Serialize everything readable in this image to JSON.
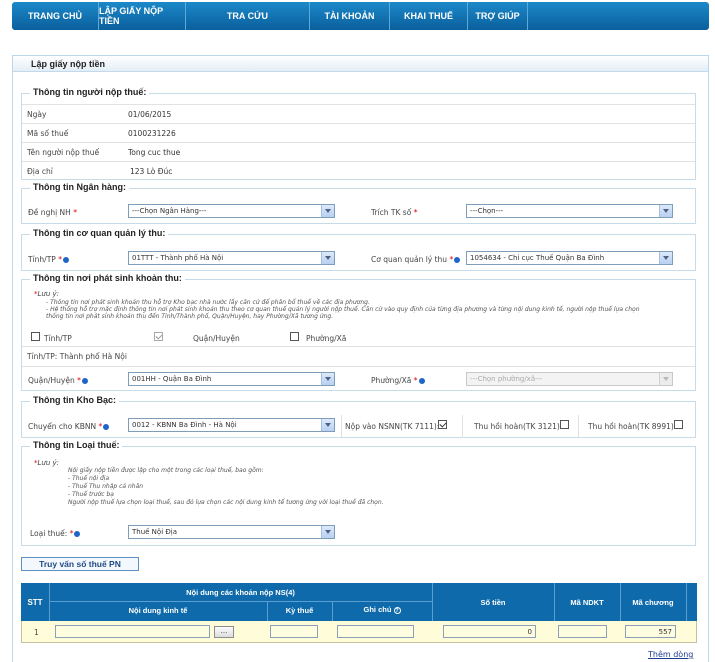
{
  "nav": [
    {
      "label": "TRANG CHỦ"
    },
    {
      "label": "LẬP GIẤY NỘP TIỀN"
    },
    {
      "label": "TRA CỨU"
    },
    {
      "label": "TÀI KHOẢN"
    },
    {
      "label": "KHAI THUẾ"
    },
    {
      "label": "TRỢ GIÚP"
    }
  ],
  "panel_title": "Lập giấy nộp tiền",
  "taxpayer": {
    "legend": "Thông tin người nộp thuế:",
    "rows": [
      {
        "label": "Ngày",
        "value": "01/06/2015"
      },
      {
        "label": "Mã số thuế",
        "value": "0100231226"
      },
      {
        "label": "Tên người nộp thuế",
        "value": "Tong cuc thue"
      },
      {
        "label": "Địa chỉ",
        "value": "123 Lò Đúc"
      }
    ]
  },
  "bank": {
    "legend": "Thông tin Ngân hàng:",
    "bank_label": "Đề nghị NH",
    "bank_value": "---Chọn Ngân Hàng---",
    "account_label": "Trích TK số",
    "account_value": "---Chọn---"
  },
  "authority": {
    "legend": "Thông tin cơ quan quản lý thu:",
    "province_label": "Tỉnh/TP",
    "province_value": "01TTT - Thành phố Hà Nội",
    "agency_label": "Cơ quan quản lý thu",
    "agency_value": "1054634 - Chi cục Thuế Quận Ba Đình"
  },
  "origin": {
    "legend": "Thông tin nơi phát sinh khoản thu:",
    "note_title": "Lưu ý:",
    "note_lines": [
      "- Thông tin nơi phát sinh khoản thu hỗ trợ Kho bạc nhà nước lấy căn cứ để phân bổ thuế về các địa phương.",
      "- Hệ thống hỗ trợ mặc định thông tin nơi phát sinh khoản thu theo cơ quan thuế quản lý người nộp thuế. Căn cứ vào quy định của từng địa phương và từng nội dung kinh tế, người nộp thuế lựa chọn",
      "thông tin nơi phát sinh khoản thu đến Tỉnh/Thành phố, Quận/Huyện, hay Phường/Xã tương ứng."
    ],
    "chk_province": "Tỉnh/TP",
    "chk_district": "Quận/Huyện",
    "chk_ward": "Phường/Xã",
    "province_text": "Tỉnh/TP:  Thành phố Hà Nội",
    "district_label": "Quận/Huyện",
    "district_value": "001HH - Quận Ba Đình",
    "ward_label": "Phường/Xã",
    "ward_value": "---Chọn phường/xã---"
  },
  "treasury": {
    "legend": "Thông tin Kho Bạc:",
    "kbnn_label": "Chuyển cho KBNN",
    "kbnn_value": "0012 - KBNN Ba Đình - Hà Nội",
    "nsnn_label": "Nộp vào NSNN(TK 7111):",
    "refund1_label": "Thu hồi hoàn(TK 3121):",
    "refund2_label": "Thu hồi hoàn(TK 8991):"
  },
  "taxtype": {
    "legend": "Thông tin Loại thuế:",
    "note_title": "Lưu ý:",
    "note_lines": [
      "Nội giấy nộp tiền được lập cho một trong các loại thuế, bao gồm:",
      "- Thuế nội địa",
      "- Thuế Thu nhập cá nhân",
      "- Thuế trước bạ",
      "Người nộp thuế lựa chọn loại thuế, sau đó lựa chọn các nội dung kinh tế tương ứng với loại thuế đã chọn."
    ],
    "label": "Loại thuế:",
    "value": "Thuế Nội Địa"
  },
  "query_button": "Truy vấn số thuế PN",
  "table": {
    "col_stt": "STT",
    "group_title": "Nội dung các khoản nộp NS(4)",
    "col_content": "Nội dung kinh tế",
    "col_period": "Kỳ thuế",
    "col_note": "Ghi chú",
    "col_amount": "Số tiền",
    "col_ndkt": "Mã NDKT",
    "col_chapter": "Mã chương",
    "rows": [
      {
        "stt": "1",
        "browse": "...",
        "amount": "0",
        "chapter": "557"
      }
    ]
  },
  "add_row_link": "Thêm dòng"
}
